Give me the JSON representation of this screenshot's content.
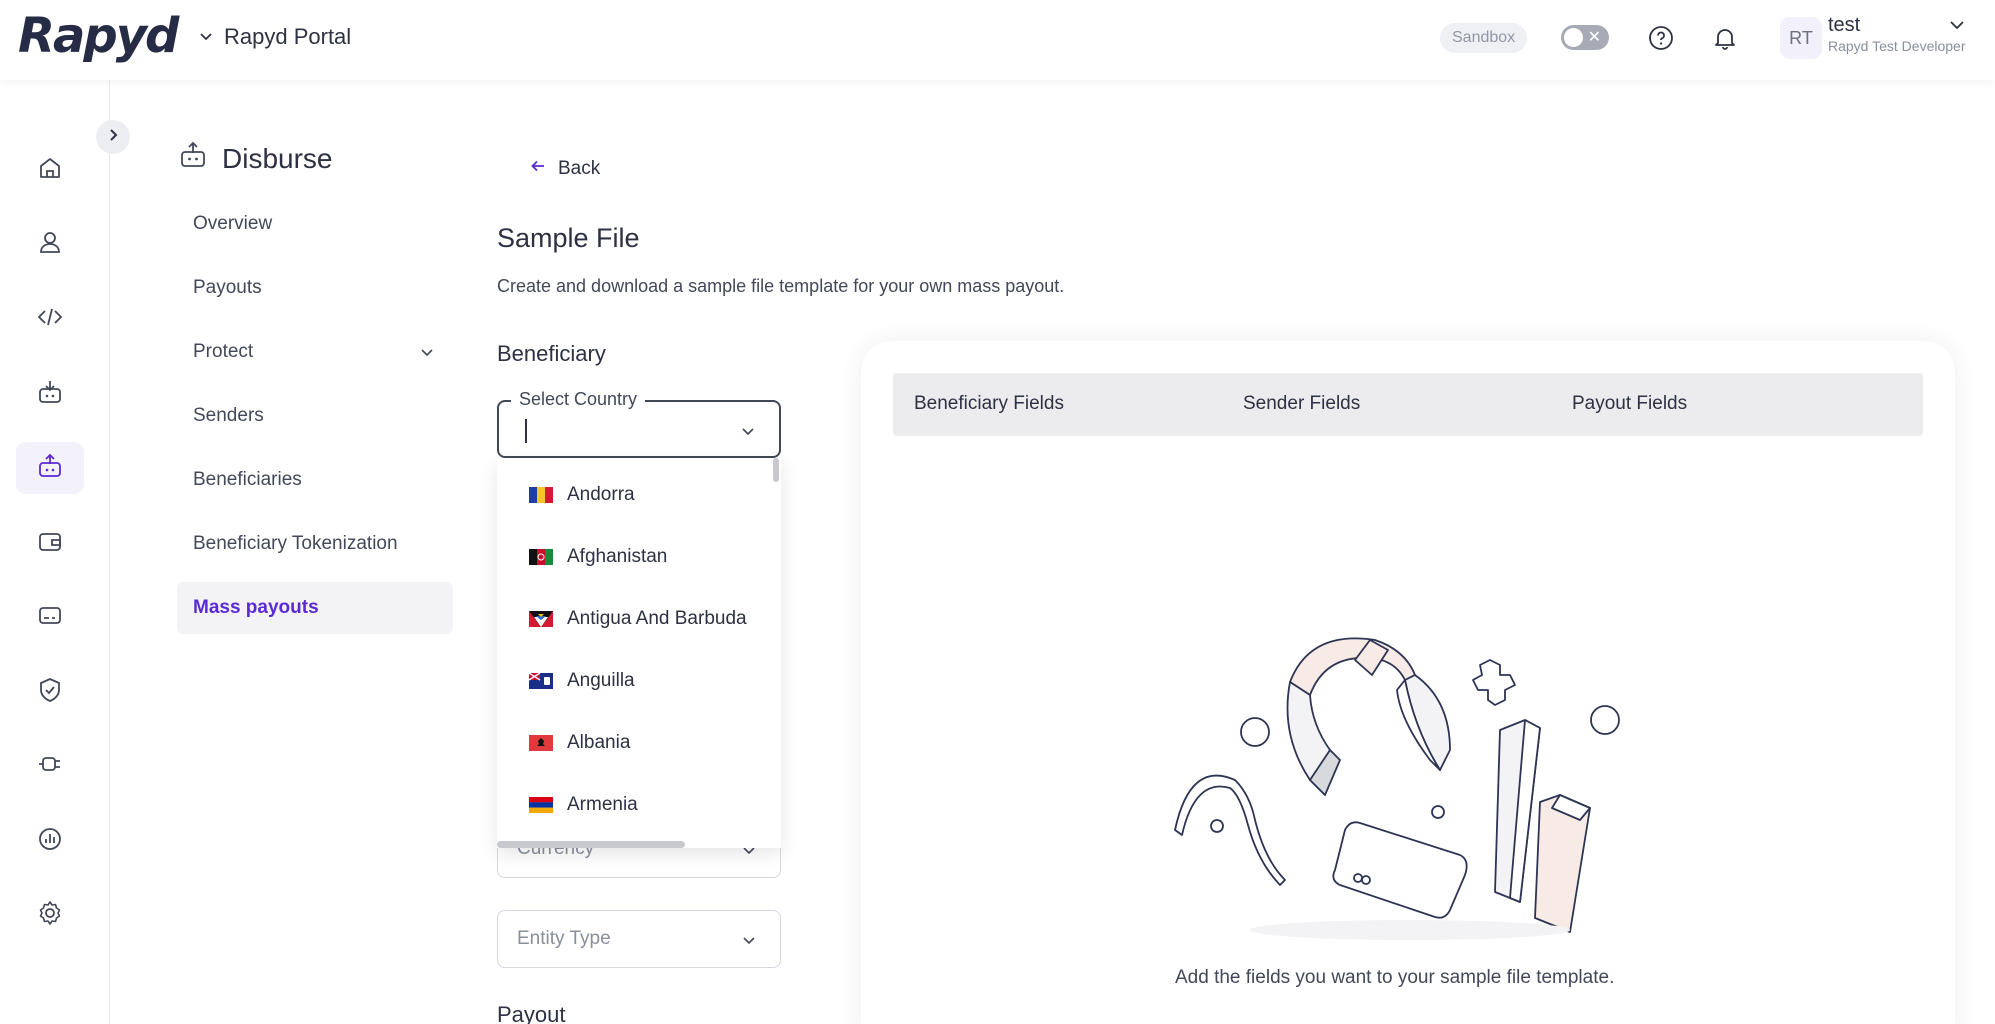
{
  "header": {
    "logo": "Rapyd",
    "portal_label": "Rapyd Portal",
    "sandbox_badge": "Sandbox",
    "user": {
      "initials": "RT",
      "name": "test",
      "role": "Rapyd Test Developer"
    }
  },
  "rail": {
    "items": [
      {
        "icon": "home-icon"
      },
      {
        "icon": "user-icon"
      },
      {
        "icon": "code-icon"
      },
      {
        "icon": "collect-icon"
      },
      {
        "icon": "disburse-icon",
        "active": true
      },
      {
        "icon": "wallet-icon"
      },
      {
        "icon": "card-icon"
      },
      {
        "icon": "shield-check-icon"
      },
      {
        "icon": "plug-icon"
      },
      {
        "icon": "reports-icon"
      },
      {
        "icon": "settings-icon"
      }
    ]
  },
  "subnav": {
    "title": "Disburse",
    "items": [
      {
        "label": "Overview"
      },
      {
        "label": "Payouts"
      },
      {
        "label": "Protect"
      },
      {
        "label": "Senders"
      },
      {
        "label": "Beneficiaries"
      },
      {
        "label": "Beneficiary Tokenization"
      },
      {
        "label": "Mass payouts",
        "active": true
      }
    ]
  },
  "main": {
    "back_label": "Back",
    "title": "Sample File",
    "subtitle": "Create and download a sample file template for your own mass payout.",
    "beneficiary_section": "Beneficiary",
    "country_field": {
      "legend": "Select Country",
      "value": ""
    },
    "currency_field": {
      "placeholder": "Currency"
    },
    "entity_field": {
      "placeholder": "Entity Type"
    },
    "payout_section": "Payout",
    "country_options": [
      {
        "name": "Andorra",
        "flag": "andorra"
      },
      {
        "name": "Afghanistan",
        "flag": "afghanistan"
      },
      {
        "name": "Antigua And Barbuda",
        "flag": "antigua"
      },
      {
        "name": "Anguilla",
        "flag": "anguilla"
      },
      {
        "name": "Albania",
        "flag": "albania"
      },
      {
        "name": "Armenia",
        "flag": "armenia"
      }
    ]
  },
  "panel": {
    "tabs": [
      {
        "label": "Beneficiary Fields"
      },
      {
        "label": "Sender Fields"
      },
      {
        "label": "Payout Fields"
      }
    ],
    "empty_message": "Add the fields you want to your sample file template."
  }
}
